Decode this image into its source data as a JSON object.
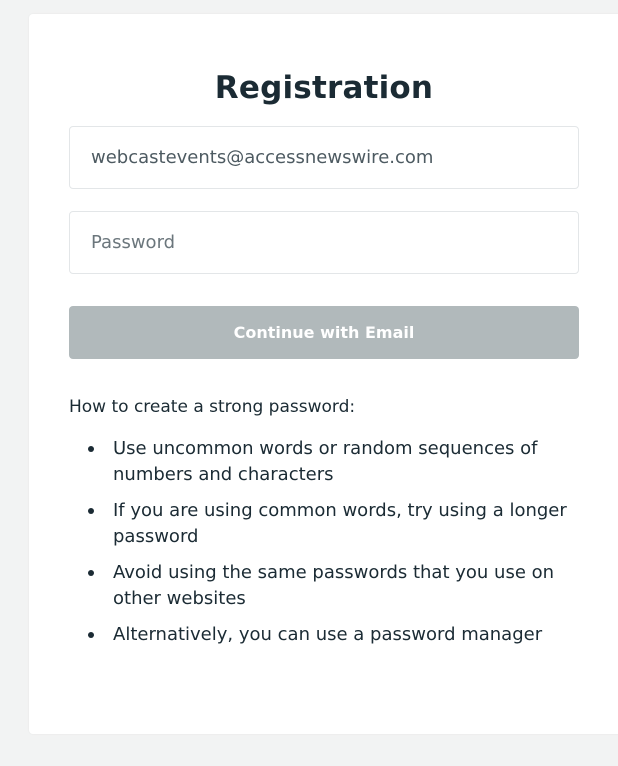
{
  "form": {
    "title": "Registration",
    "email_value": "webcastevents@accessnewswire.com",
    "password_placeholder": "Password",
    "continue_label": "Continue with Email"
  },
  "tips": {
    "heading": "How to create a strong password:",
    "items": [
      "Use uncommon words or random sequences of numbers and characters",
      "If you are using common words, try using a longer password",
      "Avoid using the same passwords that you use on other websites",
      "Alternatively, you can use a password manager"
    ]
  },
  "colors": {
    "page_background": "#f2f3f3",
    "card_background": "#ffffff",
    "text": "#1b2b34",
    "button_disabled": "#b1b9bb"
  }
}
